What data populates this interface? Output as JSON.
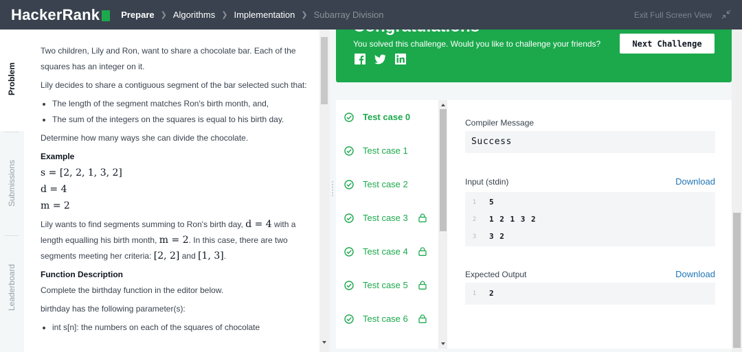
{
  "topbar": {
    "logo": "HackerRank",
    "breadcrumbs": [
      "Prepare",
      "Algorithms",
      "Implementation",
      "Subarray Division"
    ],
    "fullscreen_label": "Exit Full Screen View"
  },
  "tabs": {
    "problem": "Problem",
    "submissions": "Submissions",
    "leaderboard": "Leaderboard"
  },
  "problem": {
    "p1": "Two children, Lily and Ron, want to share a chocolate bar. Each of the squares has an integer on it.",
    "p2": "Lily decides to share a contiguous segment of the bar selected such that:",
    "bullet1": "The length of the segment matches Ron's birth month, and,",
    "bullet2": "The sum of the integers on the squares is equal to his birth day.",
    "p3": "Determine how many ways she can divide the chocolate.",
    "example_heading": "Example",
    "math_s": "s = [2, 2, 1, 3, 2]",
    "math_d": "d = 4",
    "math_m": "m = 2",
    "p4_a": "Lily wants to find segments summing to Ron's birth day, ",
    "p4_d": "d = 4",
    "p4_b": " with a length equalling his birth month, ",
    "p4_m": "m = 2",
    "p4_c": ". In this case, there are two segments meeting her criteria: ",
    "p4_seg1": "[2, 2]",
    "p4_and": " and ",
    "p4_seg2": "[1, 3]",
    "p4_end": ".",
    "func_heading": "Function Description",
    "p5": "Complete the birthday function in the editor below.",
    "p6": "birthday has the following parameter(s):",
    "bullet3": "int s[n]: the numbers on each of the squares of chocolate"
  },
  "banner": {
    "title": "Congratulations",
    "subtitle": "You solved this challenge. Would you like to challenge your friends?",
    "next_button": "Next Challenge",
    "color": "#1ba94c"
  },
  "test_cases": [
    {
      "label": "Test case 0",
      "locked": false
    },
    {
      "label": "Test case 1",
      "locked": false
    },
    {
      "label": "Test case 2",
      "locked": false
    },
    {
      "label": "Test case 3",
      "locked": true
    },
    {
      "label": "Test case 4",
      "locked": true
    },
    {
      "label": "Test case 5",
      "locked": true
    },
    {
      "label": "Test case 6",
      "locked": true
    }
  ],
  "output": {
    "compiler_label": "Compiler Message",
    "compiler_value": "Success",
    "input_label": "Input (stdin)",
    "download_label": "Download",
    "input_lines": [
      {
        "n": "1",
        "text": "5"
      },
      {
        "n": "2",
        "text": "1 2 1 3 2"
      },
      {
        "n": "3",
        "text": "3 2"
      }
    ],
    "expected_label": "Expected Output",
    "expected_lines": [
      {
        "n": "1",
        "text": "2"
      }
    ]
  }
}
